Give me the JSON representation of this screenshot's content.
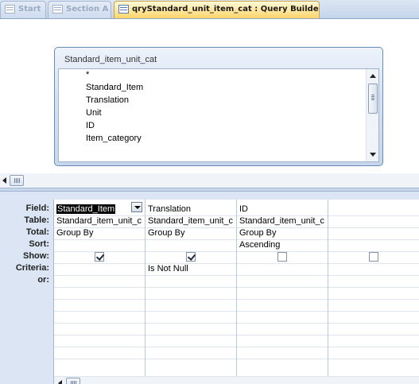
{
  "tabs": [
    {
      "label": "Start",
      "active": false
    },
    {
      "label": "Section A",
      "active": false
    },
    {
      "label": "qryStandard_unit_item_cat : Query Builder",
      "active": true
    }
  ],
  "field_list": {
    "title": "Standard_item_unit_cat",
    "items": [
      "*",
      "Standard_Item",
      "Translation",
      "Unit",
      "ID",
      "Item_category"
    ]
  },
  "grid": {
    "row_labels": [
      "Field:",
      "Table:",
      "Total:",
      "Sort:",
      "Show:",
      "Criteria:",
      "or:"
    ],
    "columns": [
      {
        "field": "Standard_Item",
        "table": "Standard_item_unit_c",
        "total": "Group By",
        "sort": "",
        "show": true,
        "criteria": "",
        "or": ""
      },
      {
        "field": "Translation",
        "table": "Standard_item_unit_c",
        "total": "Group By",
        "sort": "",
        "show": true,
        "criteria": "Is Not Null",
        "or": ""
      },
      {
        "field": "ID",
        "table": "Standard_item_unit_c",
        "total": "Group By",
        "sort": "Ascending",
        "show": false,
        "criteria": "",
        "or": ""
      },
      {
        "field": "",
        "table": "",
        "total": "",
        "sort": "",
        "show": false,
        "criteria": "",
        "or": ""
      }
    ]
  },
  "colors": {
    "active_tab": "#ffd56b",
    "pane_bg": "#dbe5f3",
    "selection": "#000000"
  }
}
